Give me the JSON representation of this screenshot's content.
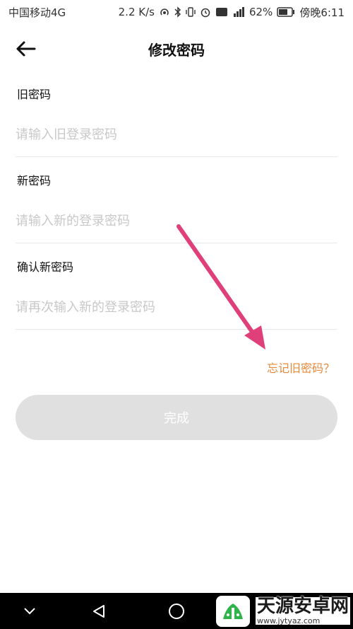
{
  "status_bar": {
    "carrier": "中国移动4G",
    "speed": "2.2 K/s",
    "battery": "62%",
    "time": "傍晚6:11"
  },
  "header": {
    "title": "修改密码"
  },
  "form": {
    "fields": [
      {
        "label": "旧密码",
        "placeholder": "请输入旧登录密码"
      },
      {
        "label": "新密码",
        "placeholder": "请输入新的登录密码"
      },
      {
        "label": "确认新密码",
        "placeholder": "请再次输入新的登录密码"
      }
    ],
    "forgot_link": "忘记旧密码？",
    "submit_label": "完成"
  },
  "watermark": {
    "title": "天源安卓网",
    "url": "www.jytyaz.com"
  },
  "colors": {
    "accent": "#e8893a",
    "arrow": "#e0407a",
    "button_disabled": "#e0e0e0",
    "placeholder": "#c8c8c8"
  }
}
